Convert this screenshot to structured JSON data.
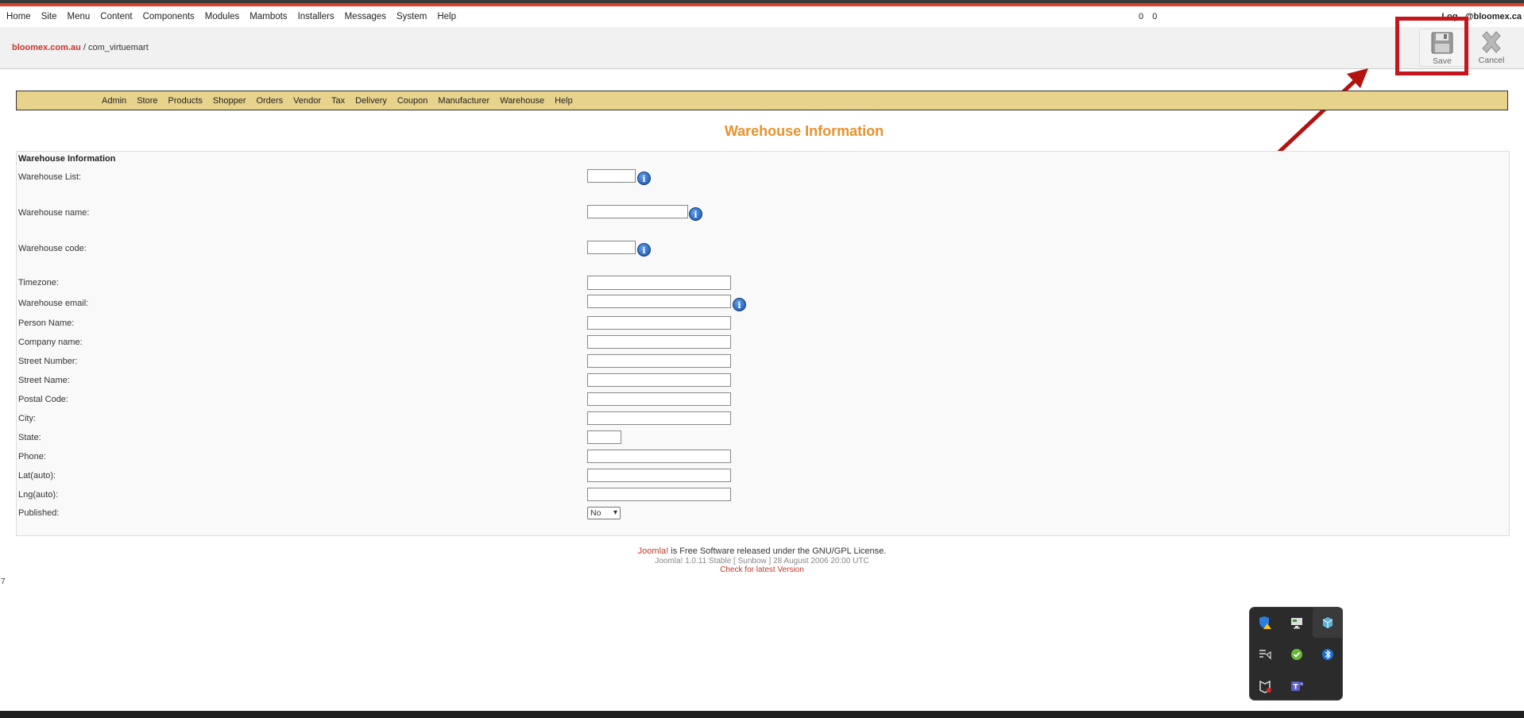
{
  "menu": {
    "items": [
      "Home",
      "Site",
      "Menu",
      "Content",
      "Components",
      "Modules",
      "Mambots",
      "Installers",
      "Messages",
      "System",
      "Help"
    ]
  },
  "counts": [
    "0",
    "0"
  ],
  "login_text": "Log...@bloomex.ca",
  "breadcrumb": {
    "site": "bloomex.com.au",
    "sep": "/",
    "component": "com_virtuemart"
  },
  "toolbar": {
    "save_label": "Save",
    "cancel_label": "Cancel"
  },
  "nav": {
    "items": [
      "Admin",
      "Store",
      "Products",
      "Shopper",
      "Orders",
      "Vendor",
      "Tax",
      "Delivery",
      "Coupon",
      "Manufacturer",
      "Warehouse",
      "Help"
    ]
  },
  "page_title": "Warehouse Information",
  "form": {
    "section_title": "Warehouse Information",
    "labels": {
      "warehouse_list": "Warehouse List:",
      "warehouse_name": "Warehouse name:",
      "warehouse_code": "Warehouse code:",
      "timezone": "Timezone:",
      "warehouse_email": "Warehouse email:",
      "person_name": "Person Name:",
      "company_name": "Company name:",
      "street_number": "Street Number:",
      "street_name": "Street Name:",
      "postal_code": "Postal Code:",
      "city": "City:",
      "state": "State:",
      "phone": "Phone:",
      "lat": "Lat(auto):",
      "lng": "Lng(auto):",
      "published": "Published:"
    },
    "published_value": "No"
  },
  "footer": {
    "brand": "Joomla!",
    "license": " is Free Software released under the GNU/GPL License.",
    "version": "Joomla! 1.0.11 Stable [ Sunbow ] 28 August 2006 20:00 UTC",
    "check": "Check for latest Version"
  },
  "page_number": "7",
  "tray_icons": [
    "shield-warning-icon",
    "display-icon",
    "cube-icon",
    "media-list-icon",
    "check-icon",
    "bluetooth-icon",
    "mcafee-icon",
    "teams-icon"
  ],
  "colors": {
    "accent": "#e8912c",
    "nav_bg": "#e8d38c",
    "annotation": "#c4161c"
  }
}
